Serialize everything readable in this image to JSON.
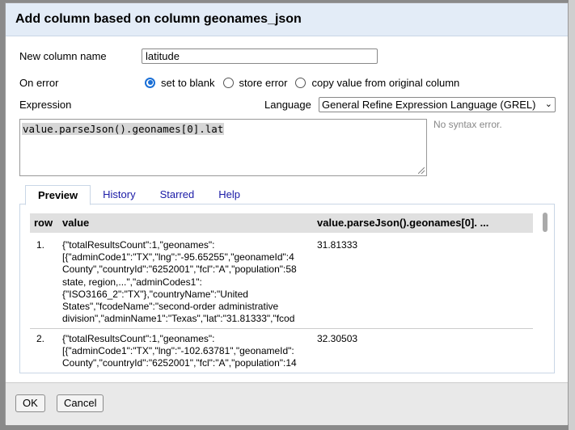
{
  "dialog": {
    "title": "Add column based on column geonames_json",
    "new_column_label": "New column name",
    "new_column_value": "latitude",
    "on_error_label": "On error",
    "on_error_options": [
      "set to blank",
      "store error",
      "copy value from original column"
    ],
    "on_error_selected": "set to blank",
    "expression_label": "Expression",
    "language_label": "Language",
    "language_value": "General Refine Expression Language (GREL)",
    "expression": "value.parseJson().geonames[0].lat",
    "syntax_status": "No syntax error."
  },
  "tabs": [
    "Preview",
    "History",
    "Starred",
    "Help"
  ],
  "active_tab": "Preview",
  "preview": {
    "columns": [
      "row",
      "value",
      "value.parseJson().geonames[0]. ..."
    ],
    "rows": [
      {
        "row": "1.",
        "value_lines": [
          "{\"totalResultsCount\":1,\"geonames\":",
          "[{\"adminCode1\":\"TX\",\"lng\":\"-95.65255\",\"geonameId\":4",
          "County\",\"countryId\":\"6252001\",\"fcl\":\"A\",\"population\":58",
          "state, region,...\",\"adminCodes1\":",
          "{\"ISO3166_2\":\"TX\"},\"countryName\":\"United",
          "States\",\"fcodeName\":\"second-order administrative",
          "division\",\"adminName1\":\"Texas\",\"lat\":\"31.81333\",\"fcod"
        ],
        "result": "31.81333"
      },
      {
        "row": "2.",
        "value_lines": [
          "{\"totalResultsCount\":1,\"geonames\":",
          "[{\"adminCode1\":\"TX\",\"lng\":\"-102.63781\",\"geonameId\":",
          "County\",\"countryId\":\"6252001\",\"fcl\":\"A\",\"population\":14"
        ],
        "result": "32.30503"
      }
    ]
  },
  "buttons": {
    "ok": "OK",
    "cancel": "Cancel"
  },
  "colors": {
    "header_bg": "#e3ecf7",
    "link": "#1a1aa6",
    "radio_accent": "#1a6fd6"
  }
}
